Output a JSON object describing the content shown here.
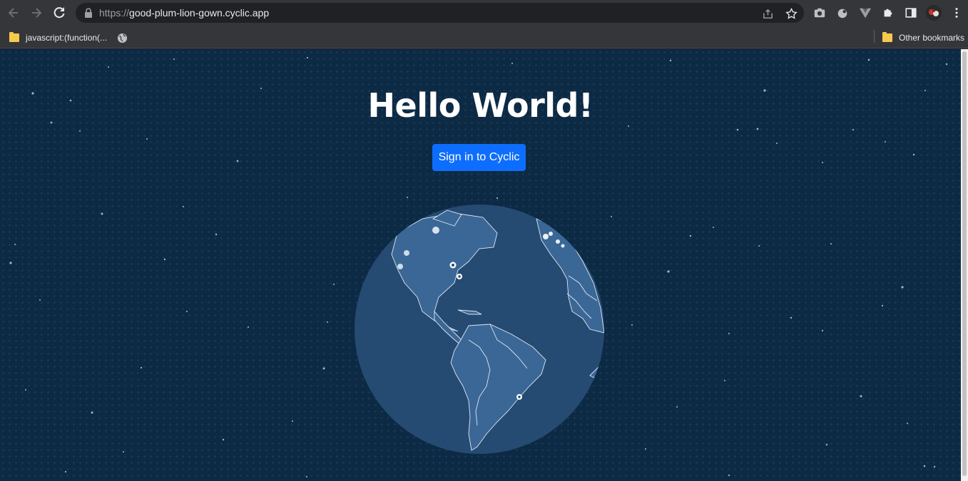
{
  "browser": {
    "url_scheme": "https://",
    "url_host": "good-plum-lion-gown.cyclic.app"
  },
  "bookmarks": {
    "items": [
      {
        "label": "javascript:(function(..."
      },
      {
        "label": ""
      }
    ],
    "other_label": "Other bookmarks"
  },
  "page": {
    "heading": "Hello World!",
    "signin_label": "Sign in to Cyclic"
  },
  "colors": {
    "background": "#0d2a45",
    "button": "#0d6efd",
    "globe_ocean": "#264b72",
    "globe_land": "#3a6796"
  }
}
